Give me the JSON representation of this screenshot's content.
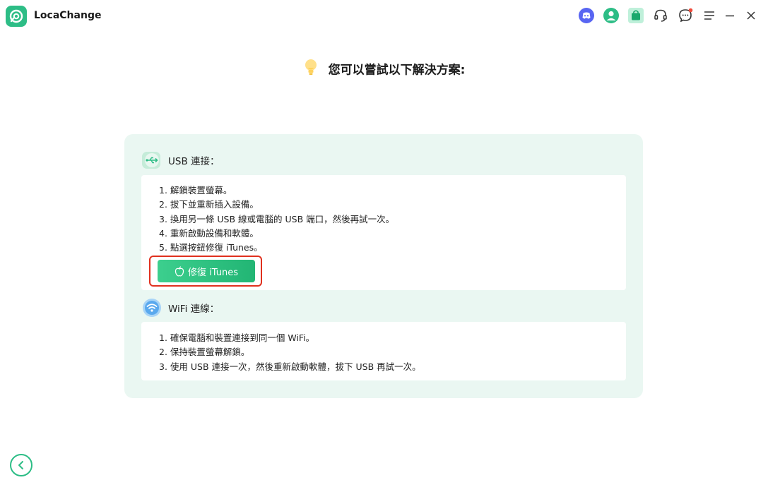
{
  "app": {
    "name": "LocaChange"
  },
  "titlebar": {
    "icons": [
      "discord-icon",
      "user-avatar-icon",
      "store-bag-icon",
      "support-headset-icon",
      "feedback-chat-icon",
      "menu-icon",
      "minimize-icon",
      "close-icon"
    ],
    "notification_dot_color": "#f04a3a"
  },
  "headline": {
    "text": "您可以嘗試以下解決方案:"
  },
  "usb": {
    "title": "USB 連接：",
    "steps": [
      "1. 解鎖裝置螢幕。",
      "2. 拔下並重新插入設備。",
      "3. 換用另一條 USB 線或電腦的 USB 端口，然後再試一次。",
      "4. 重新啟動設備和軟體。",
      "5. 點選按鈕修復 iTunes。"
    ],
    "fix_button": "修復 iTunes"
  },
  "wifi": {
    "title": "WiFi 連線：",
    "steps": [
      "1. 確保電腦和裝置連接到同一個 WiFi。",
      "2. 保持裝置螢幕解鎖。",
      "3. 使用 USB 連接一次，然後重新啟動軟體，拔下 USB 再試一次。"
    ]
  },
  "colors": {
    "accent": "#2dbd86",
    "panel_bg": "#eaf7f2",
    "highlight_border": "#e0301e"
  }
}
